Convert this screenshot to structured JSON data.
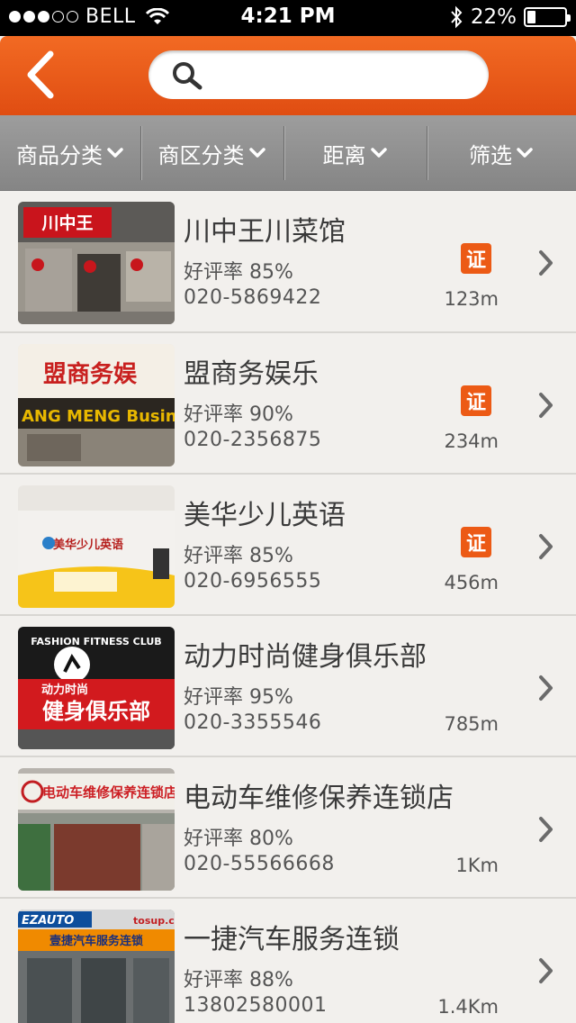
{
  "status_bar": {
    "carrier": "BELL",
    "time": "4:21 PM",
    "battery": "22%",
    "battery_level": 0.22
  },
  "nav": {
    "search_placeholder": ""
  },
  "filters": [
    {
      "label": "商品分类"
    },
    {
      "label": "商区分类"
    },
    {
      "label": "距离"
    },
    {
      "label": "筛选"
    }
  ],
  "items": [
    {
      "name": "川中王川菜馆",
      "rating": "好评率 85%",
      "phone": "020-5869422",
      "distance": "123m",
      "certified": true,
      "cert_label": "证",
      "sign_text": "川中王",
      "colors": {
        "sign": "#c9141c"
      }
    },
    {
      "name": "盟商务娱乐",
      "rating": "好评率 90%",
      "phone": "020-2356875",
      "distance": "234m",
      "certified": true,
      "cert_label": "证",
      "sign_text": "盟商务娱",
      "sign_sub": "ANG MENG Busines",
      "colors": {
        "sign": "#e8b800"
      }
    },
    {
      "name": "美华少儿英语",
      "rating": "好评率 85%",
      "phone": "020-6956555",
      "distance": "456m",
      "certified": true,
      "cert_label": "证",
      "sign_text": "美华少儿英语",
      "colors": {
        "sign": "#f6c419"
      }
    },
    {
      "name": "动力时尚健身俱乐部",
      "rating": "好评率 95%",
      "phone": "020-3355546",
      "distance": "785m",
      "certified": false,
      "cert_label": "",
      "sign_text": "健身俱乐部",
      "sign_sub": "动力时尚",
      "sign_arc": "FASHION FITNESS CLUB",
      "colors": {
        "sign": "#d21a1e"
      }
    },
    {
      "name": "电动车维修保养连锁店",
      "rating": "好评率 80%",
      "phone": "020-55566668",
      "distance": "1Km",
      "certified": false,
      "cert_label": "",
      "sign_text": "电动车维修保养连锁店",
      "colors": {
        "sign": "#cc1f24"
      }
    },
    {
      "name": "一捷汽车服务连锁",
      "rating": "好评率 88%",
      "phone": "13802580001",
      "distance": "1.4Km",
      "certified": false,
      "cert_label": "",
      "sign_text": "壹捷汽车服务连锁",
      "sign_sub": "EZAUTO",
      "sign_sub2": "tosup.c",
      "colors": {
        "sign": "#f08a00"
      }
    }
  ],
  "theme": {
    "accent": "#ec5a15",
    "nav_bg": "#e85a18",
    "filter_bg": "#8f8f8f"
  }
}
